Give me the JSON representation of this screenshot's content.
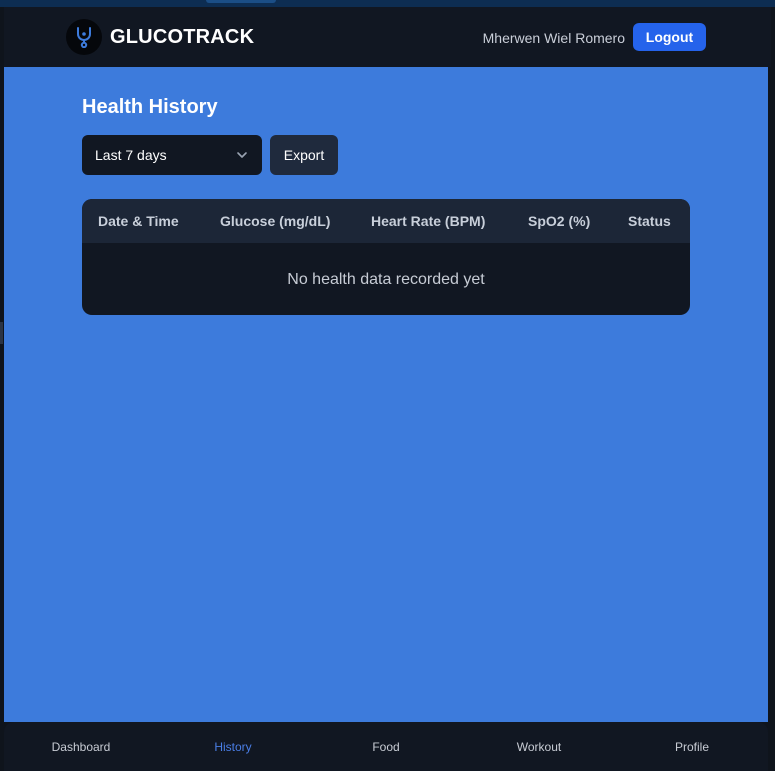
{
  "app": {
    "brand": "GLUCOTRACK",
    "logo_icon": "stethoscope-icon",
    "user_name": "Mherwen Wiel Romero",
    "logout_label": "Logout"
  },
  "page": {
    "title": "Health History",
    "range_select": {
      "value": "Last 7 days",
      "icon": "chevron-down-icon"
    },
    "export_label": "Export"
  },
  "table": {
    "columns": [
      "Date & Time",
      "Glucose (mg/dL)",
      "Heart Rate (BPM)",
      "SpO2 (%)",
      "Status"
    ],
    "rows": [],
    "empty_message": "No health data recorded yet"
  },
  "nav": {
    "items": [
      {
        "label": "Dashboard",
        "active": false
      },
      {
        "label": "History",
        "active": true
      },
      {
        "label": "Food",
        "active": false
      },
      {
        "label": "Workout",
        "active": false
      },
      {
        "label": "Profile",
        "active": false
      }
    ]
  },
  "colors": {
    "accent": "#2563eb",
    "content_background": "#3d7bdc",
    "surface_dark": "#111722",
    "active_nav": "#4a7ee6"
  }
}
